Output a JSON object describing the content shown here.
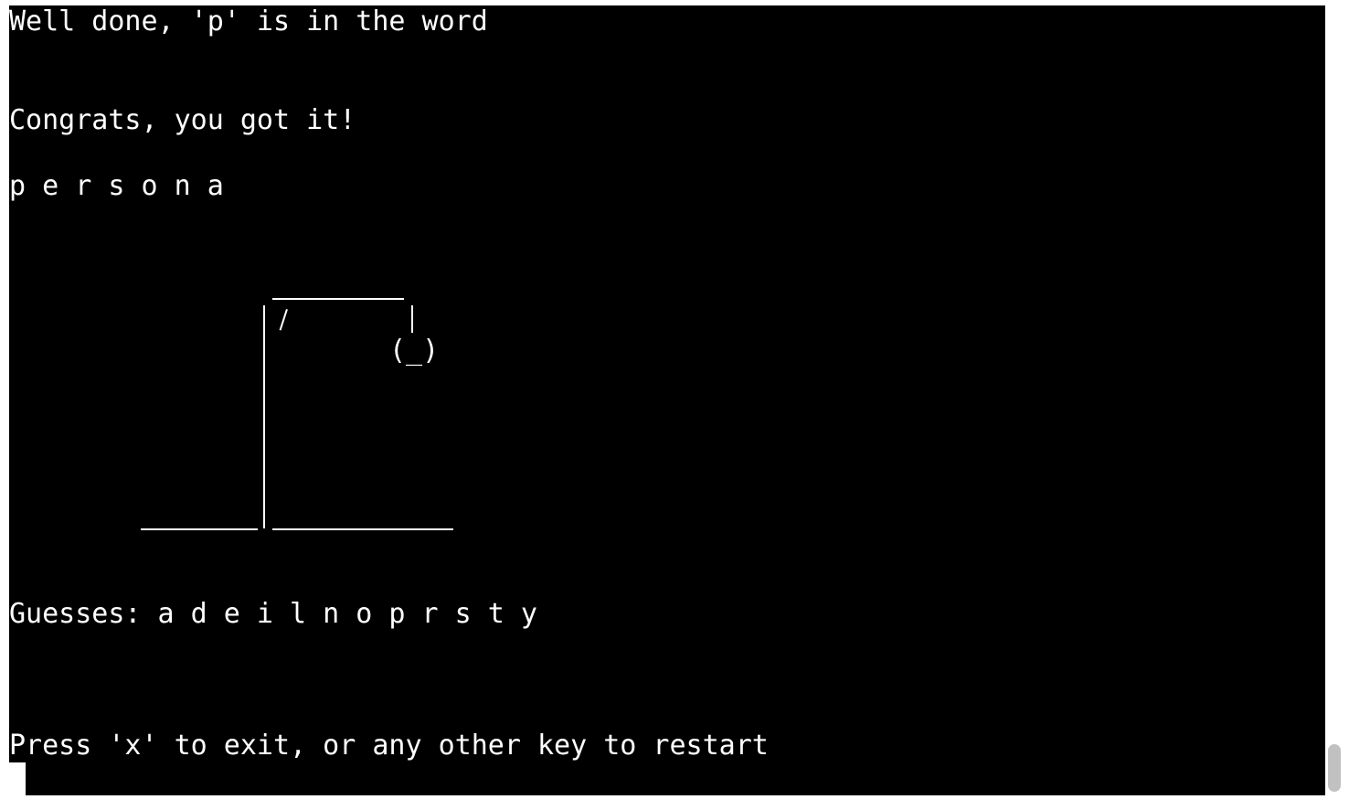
{
  "terminal": {
    "feedback": "Well done, 'p' is in the word",
    "result": "Congrats, you got it!",
    "word": "p e r s o n a",
    "head": "(_)",
    "guesses": "Guesses: a d e i l n o p r s t y",
    "prompt": "Press 'x' to exit, or any other key to restart"
  },
  "colors": {
    "background": "#000000",
    "text": "#ffffff",
    "page": "#ffffff"
  }
}
